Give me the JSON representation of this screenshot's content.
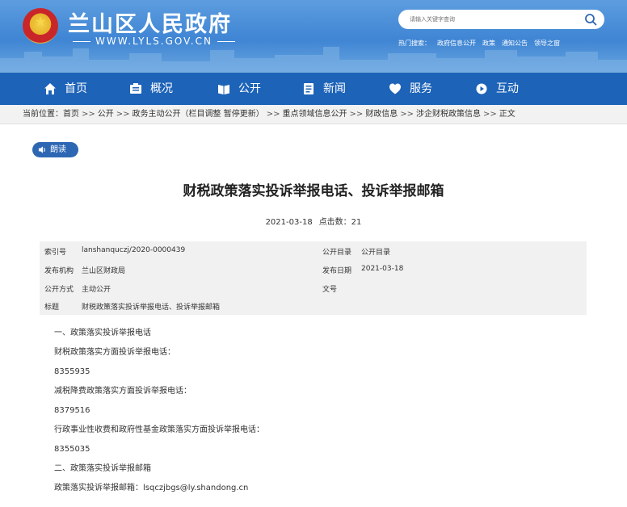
{
  "header": {
    "title": "兰山区人民政府",
    "domain": "WWW.LYLS.GOV.CN",
    "search_placeholder": "请输入关键字查询",
    "hot_label": "热门搜索：",
    "hot_items": [
      "政府信息公开",
      "政策",
      "通知公告",
      "领导之窗"
    ]
  },
  "nav": [
    {
      "label": "首页",
      "icon": "home-icon"
    },
    {
      "label": "概况",
      "icon": "overview-icon"
    },
    {
      "label": "公开",
      "icon": "book-icon"
    },
    {
      "label": "新闻",
      "icon": "news-icon"
    },
    {
      "label": "服务",
      "icon": "heart-icon"
    },
    {
      "label": "互动",
      "icon": "chat-icon"
    }
  ],
  "breadcrumb": {
    "prefix": "当前位置：",
    "items": [
      "首页",
      "公开",
      "政务主动公开（栏目调整 暂停更新）",
      "重点领域信息公开",
      "财政信息",
      "涉企财税政策信息",
      "正文"
    ],
    "sep": ">>"
  },
  "read_button": "朗读",
  "article": {
    "title": "财税政策落实投诉举报电话、投诉举报邮箱",
    "date": "2021-03-18",
    "clicks": "点击数：21"
  },
  "info": {
    "index_label": "索引号",
    "index_value": "lanshanquczj/2020-0000439",
    "catalog_label": "公开目录",
    "catalog_value": "公开目录",
    "org_label": "发布机构",
    "org_value": "兰山区财政局",
    "pubdate_label": "发布日期",
    "pubdate_value": "2021-03-18",
    "mode_label": "公开方式",
    "mode_value": "主动公开",
    "docno_label": "文号",
    "docno_value": "",
    "title_label": "标题",
    "title_value": "财税政策落实投诉举报电话、投诉举报邮箱"
  },
  "content": [
    "一、政策落实投诉举报电话",
    "财税政策落实方面投诉举报电话：",
    "8355935",
    "减税降费政策落实方面投诉举报电话：",
    "8379516",
    "行政事业性收费和政府性基金政策落实方面投诉举报电话：",
    "8355035",
    "二、政策落实投诉举报邮箱",
    "政策落实投诉举报邮箱：lsqczjbgs@ly.shandong.cn"
  ],
  "colors": {
    "header_blue": "#3f85d4",
    "nav_blue": "#1d63b8",
    "read_btn": "#2d67b4"
  }
}
